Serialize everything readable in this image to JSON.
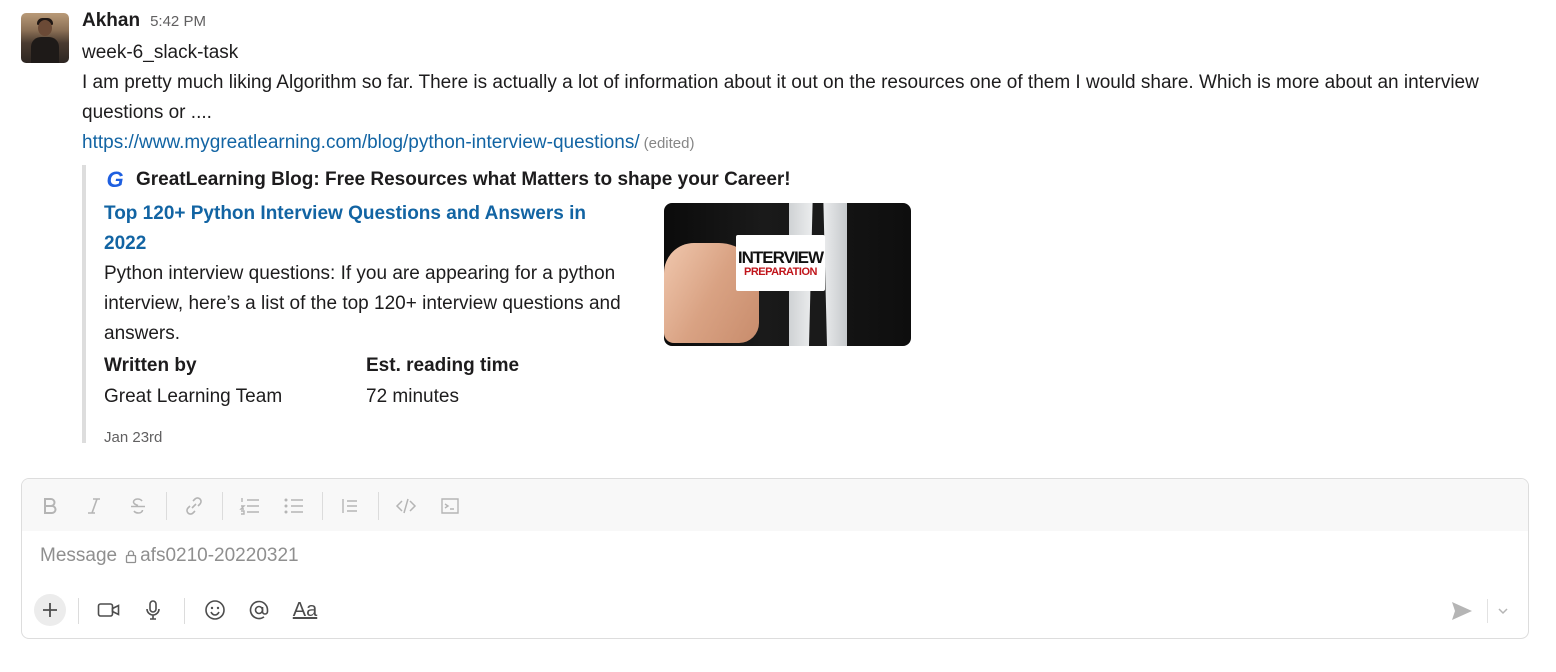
{
  "message": {
    "author": "Akhan",
    "time": "5:42 PM",
    "line1": "week-6_slack-task",
    "text": "I am pretty much liking Algorithm so far. There is actually a lot of information about it out on the resources one of them I would share. Which is more about an interview questions or ....",
    "link": "https://www.mygreatlearning.com/blog/python-interview-questions/",
    "edited": "(edited)"
  },
  "unfurl": {
    "site_icon_letter": "G",
    "site_name": "GreatLearning Blog: Free Resources what Matters to shape your Career!",
    "title": "Top 120+ Python Interview Questions and Answers in 2022",
    "description": "Python interview questions: If you are appearing for a python interview, here’s a list of the top 120+ interview questions and answers.",
    "fields": [
      {
        "name": "Written by",
        "value": "Great Learning Team"
      },
      {
        "name": "Est. reading time",
        "value": "72 minutes"
      }
    ],
    "date": "Jan 23rd",
    "image_text_top": "INTERVIEW",
    "image_text_bottom": "PREPARATION"
  },
  "composer": {
    "placeholder_prefix": "Message",
    "channel": "afs0210-20220321",
    "aa_label": "Aa",
    "toolbar_icons": [
      "bold-icon",
      "italic-icon",
      "strikethrough-icon",
      "link-icon",
      "numbered-list-icon",
      "bulleted-list-icon",
      "blockquote-icon",
      "code-icon",
      "code-block-icon"
    ],
    "bottom_icons": [
      "plus-icon",
      "video-icon",
      "microphone-icon",
      "emoji-icon",
      "mention-icon",
      "formatting-icon",
      "send-icon",
      "chevron-down-icon"
    ]
  }
}
